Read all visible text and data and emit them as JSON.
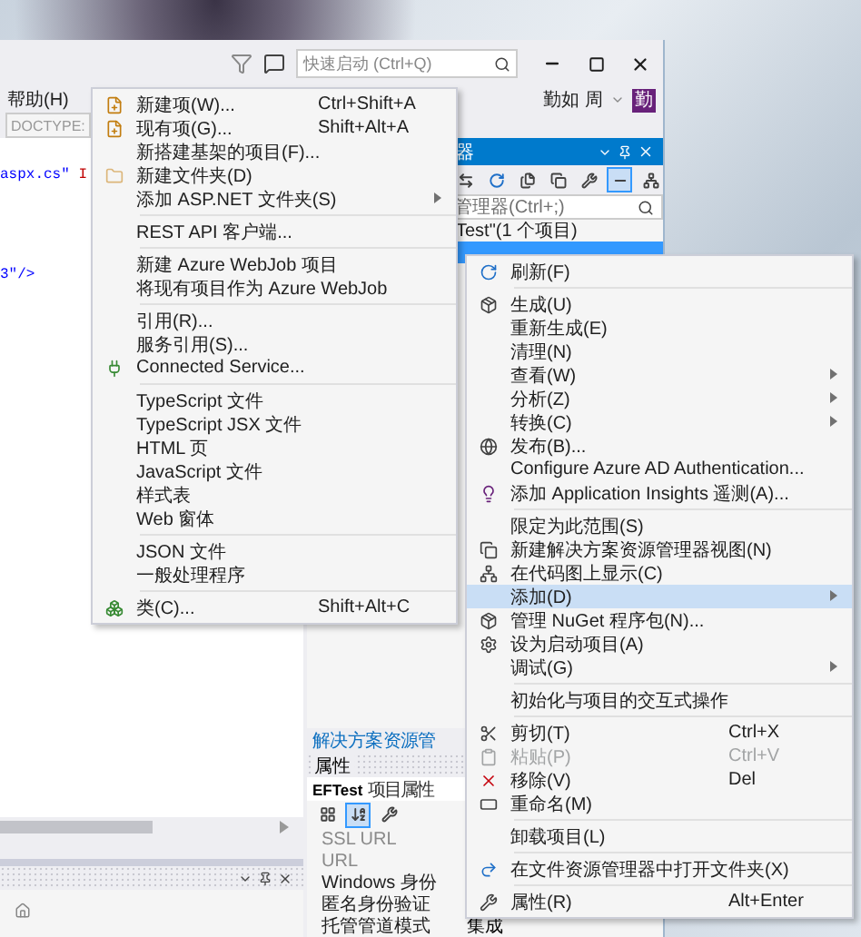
{
  "title_bar": {
    "quick_launch": {
      "placeholder": "快速启动 (Ctrl+Q)"
    }
  },
  "menu_bar": {
    "items": [
      "帮助(H)"
    ],
    "user": "勤如 周",
    "avatar": "勤"
  },
  "doc_toolbar": {
    "field": "DOCTYPE:"
  },
  "editor": {
    "lines": [
      {
        "tokens": [
          {
            "text": "aspx.cs\"",
            "kind": "value"
          },
          {
            "text": "I",
            "kind": "attribute"
          }
        ]
      },
      {
        "tokens": [
          {
            "text": "3\"/>",
            "kind": "value"
          }
        ]
      }
    ]
  },
  "solution_explorer": {
    "title": "器",
    "toolbar": [
      {
        "selected": false
      },
      {
        "selected": false
      },
      {
        "selected": false
      },
      {
        "selected": false
      },
      {
        "selected": false
      },
      {
        "selected": true
      },
      {
        "selected": false
      }
    ],
    "search": {
      "placeholder": "管理器(Ctrl+;)"
    },
    "tree": [
      {
        "label": "Test\"(1 个项目)",
        "selected": false
      },
      {
        "selected": true
      }
    ],
    "tab_link": "解决方案资源管"
  },
  "properties": {
    "title": "属性",
    "object": "EFTest",
    "object_type": "项目属性",
    "toolbar": [
      {
        "selected": false
      },
      {
        "selected": true
      },
      {
        "selected": false
      }
    ],
    "rows": [
      {
        "name": "SSL URL",
        "disabled": true
      },
      {
        "name": "URL",
        "disabled": true
      },
      {
        "name": "Windows 身份",
        "disabled": false
      },
      {
        "name": "匿名身份验证",
        "disabled": false
      },
      {
        "name": "托管管道模式",
        "disabled": false,
        "value": "集成"
      }
    ]
  },
  "add_menu": {
    "items": [
      {
        "kind": "item",
        "label": "新建项(W)...",
        "shortcut": "Ctrl+Shift+A",
        "submenu": false,
        "selected": false,
        "disabled": false
      },
      {
        "kind": "item",
        "label": "现有项(G)...",
        "shortcut": "Shift+Alt+A",
        "submenu": false,
        "selected": false,
        "disabled": false
      },
      {
        "kind": "item",
        "label": "新搭建基架的项目(F)...",
        "submenu": false,
        "selected": false,
        "disabled": false
      },
      {
        "kind": "item",
        "label": "新建文件夹(D)",
        "submenu": false,
        "selected": false,
        "disabled": false
      },
      {
        "kind": "item",
        "label": "添加 ASP.NET 文件夹(S)",
        "submenu": true,
        "selected": false,
        "disabled": false
      },
      {
        "kind": "separator"
      },
      {
        "kind": "item",
        "label": "REST API 客户端...",
        "submenu": false,
        "selected": false,
        "disabled": false
      },
      {
        "kind": "separator"
      },
      {
        "kind": "item",
        "label": "新建 Azure WebJob 项目",
        "submenu": false,
        "selected": false,
        "disabled": false
      },
      {
        "kind": "item",
        "label": "将现有项目作为 Azure WebJob",
        "submenu": false,
        "selected": false,
        "disabled": false
      },
      {
        "kind": "separator"
      },
      {
        "kind": "item",
        "label": "引用(R)...",
        "submenu": false,
        "selected": false,
        "disabled": false
      },
      {
        "kind": "item",
        "label": "服务引用(S)...",
        "submenu": false,
        "selected": false,
        "disabled": false
      },
      {
        "kind": "item",
        "label": "Connected Service...",
        "submenu": false,
        "selected": false,
        "disabled": false
      },
      {
        "kind": "separator"
      },
      {
        "kind": "item",
        "label": "TypeScript 文件",
        "submenu": false,
        "selected": false,
        "disabled": false
      },
      {
        "kind": "item",
        "label": "TypeScript JSX 文件",
        "submenu": false,
        "selected": false,
        "disabled": false
      },
      {
        "kind": "item",
        "label": "HTML 页",
        "submenu": false,
        "selected": false,
        "disabled": false
      },
      {
        "kind": "item",
        "label": "JavaScript 文件",
        "submenu": false,
        "selected": false,
        "disabled": false
      },
      {
        "kind": "item",
        "label": "样式表",
        "submenu": false,
        "selected": false,
        "disabled": false
      },
      {
        "kind": "item",
        "label": "Web 窗体",
        "submenu": false,
        "selected": false,
        "disabled": false
      },
      {
        "kind": "separator"
      },
      {
        "kind": "item",
        "label": "JSON 文件",
        "submenu": false,
        "selected": false,
        "disabled": false
      },
      {
        "kind": "item",
        "label": "一般处理程序",
        "submenu": false,
        "selected": false,
        "disabled": false
      },
      {
        "kind": "separator"
      },
      {
        "kind": "item",
        "label": "类(C)...",
        "shortcut": "Shift+Alt+C",
        "submenu": false,
        "selected": false,
        "disabled": false
      }
    ]
  },
  "context_menu": {
    "items": [
      {
        "kind": "item",
        "label": "刷新(F)",
        "submenu": false,
        "selected": false,
        "disabled": false
      },
      {
        "kind": "separator"
      },
      {
        "kind": "item",
        "label": "生成(U)",
        "submenu": false,
        "selected": false,
        "disabled": false
      },
      {
        "kind": "item",
        "label": "重新生成(E)",
        "submenu": false,
        "selected": false,
        "disabled": false
      },
      {
        "kind": "item",
        "label": "清理(N)",
        "submenu": false,
        "selected": false,
        "disabled": false
      },
      {
        "kind": "item",
        "label": "查看(W)",
        "submenu": true,
        "selected": false,
        "disabled": false
      },
      {
        "kind": "item",
        "label": "分析(Z)",
        "submenu": true,
        "selected": false,
        "disabled": false
      },
      {
        "kind": "item",
        "label": "转换(C)",
        "submenu": true,
        "selected": false,
        "disabled": false
      },
      {
        "kind": "item",
        "label": "发布(B)...",
        "submenu": false,
        "selected": false,
        "disabled": false
      },
      {
        "kind": "item",
        "label": "Configure Azure AD Authentication...",
        "submenu": false,
        "selected": false,
        "disabled": false
      },
      {
        "kind": "item",
        "label": "添加 Application Insights 遥测(A)...",
        "submenu": false,
        "selected": false,
        "disabled": false
      },
      {
        "kind": "separator"
      },
      {
        "kind": "item",
        "label": "限定为此范围(S)",
        "submenu": false,
        "selected": false,
        "disabled": false
      },
      {
        "kind": "item",
        "label": "新建解决方案资源管理器视图(N)",
        "submenu": false,
        "selected": false,
        "disabled": false
      },
      {
        "kind": "item",
        "label": "在代码图上显示(C)",
        "submenu": false,
        "selected": false,
        "disabled": false
      },
      {
        "kind": "item",
        "label": "添加(D)",
        "submenu": true,
        "selected": true,
        "disabled": false
      },
      {
        "kind": "item",
        "label": "管理 NuGet 程序包(N)...",
        "submenu": false,
        "selected": false,
        "disabled": false
      },
      {
        "kind": "item",
        "label": "设为启动项目(A)",
        "submenu": false,
        "selected": false,
        "disabled": false
      },
      {
        "kind": "item",
        "label": "调试(G)",
        "submenu": true,
        "selected": false,
        "disabled": false
      },
      {
        "kind": "separator"
      },
      {
        "kind": "item",
        "label": "初始化与项目的交互式操作",
        "submenu": false,
        "selected": false,
        "disabled": false
      },
      {
        "kind": "separator"
      },
      {
        "kind": "item",
        "label": "剪切(T)",
        "shortcut": "Ctrl+X",
        "submenu": false,
        "selected": false,
        "disabled": false
      },
      {
        "kind": "item",
        "label": "粘贴(P)",
        "shortcut": "Ctrl+V",
        "submenu": false,
        "selected": false,
        "disabled": true
      },
      {
        "kind": "item",
        "label": "移除(V)",
        "shortcut": "Del",
        "submenu": false,
        "selected": false,
        "disabled": false
      },
      {
        "kind": "item",
        "label": "重命名(M)",
        "submenu": false,
        "selected": false,
        "disabled": false
      },
      {
        "kind": "separator"
      },
      {
        "kind": "item",
        "label": "卸载项目(L)",
        "submenu": false,
        "selected": false,
        "disabled": false
      },
      {
        "kind": "separator"
      },
      {
        "kind": "item",
        "label": "在文件资源管理器中打开文件夹(X)",
        "submenu": false,
        "selected": false,
        "disabled": false
      },
      {
        "kind": "separator"
      },
      {
        "kind": "item",
        "label": "属性(R)",
        "shortcut": "Alt+Enter",
        "submenu": false,
        "selected": false,
        "disabled": false
      }
    ]
  }
}
